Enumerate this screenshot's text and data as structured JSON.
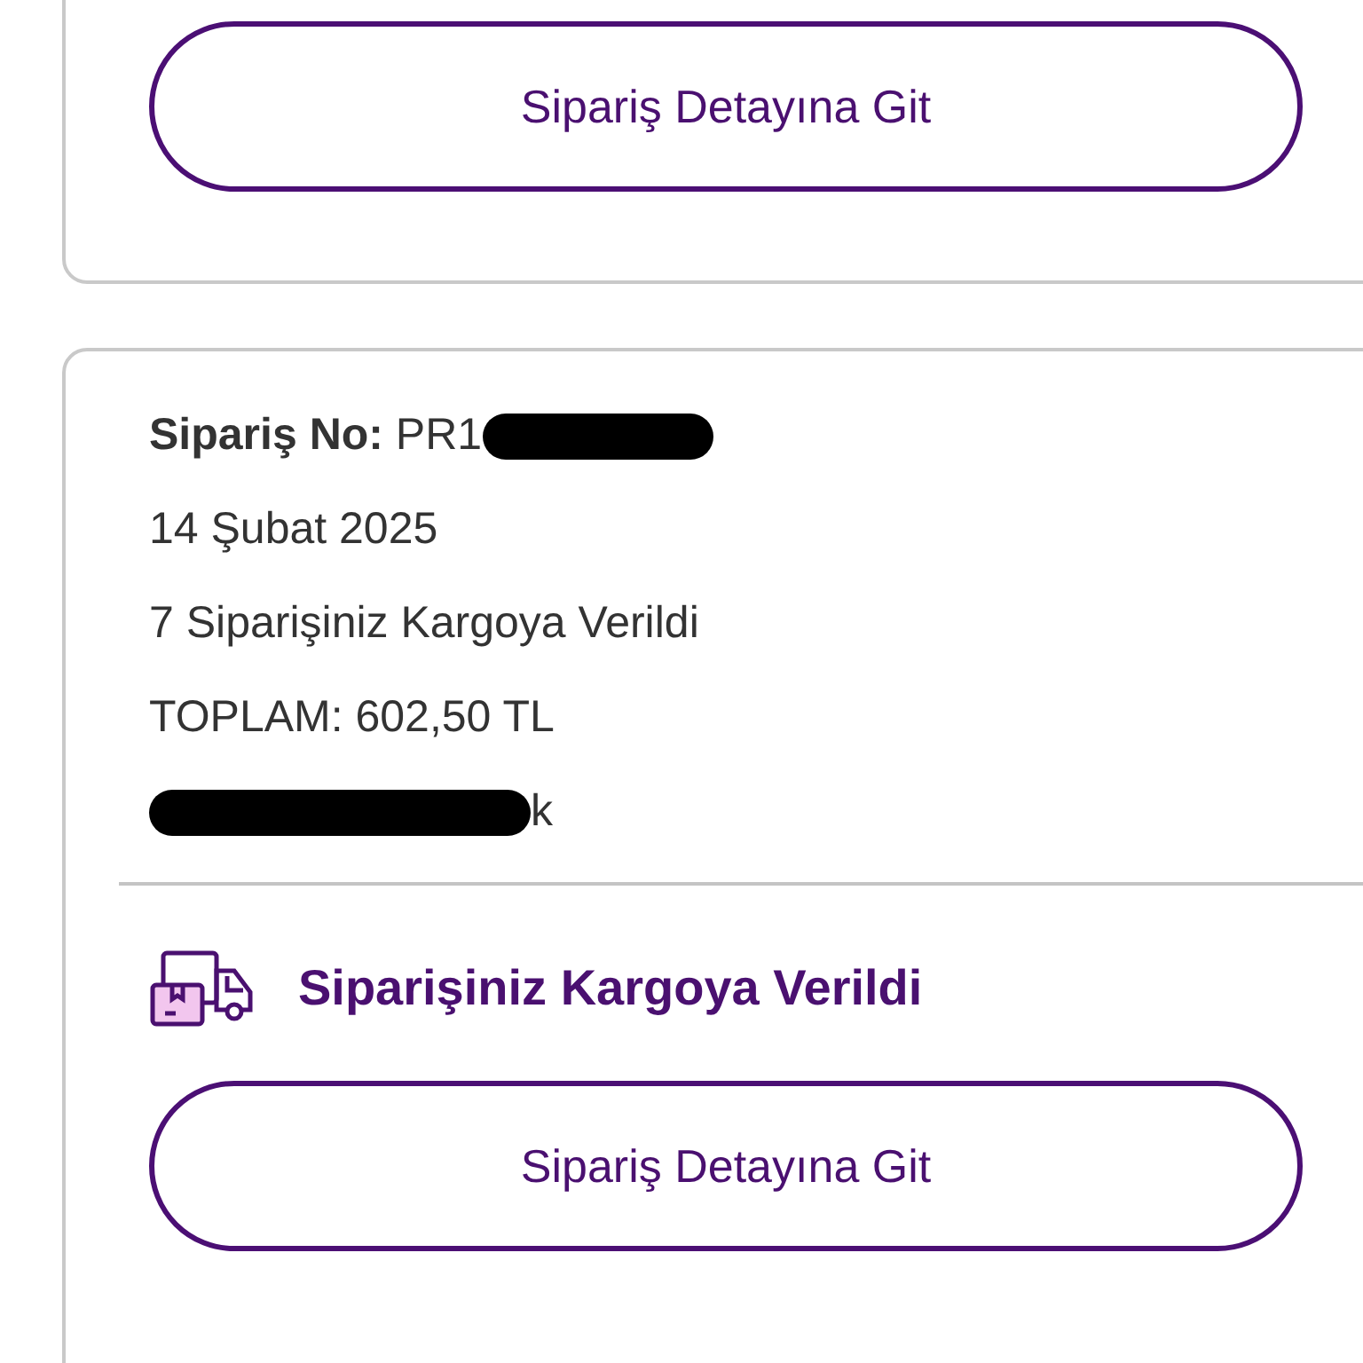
{
  "orders": [
    {
      "button": "Sipariş Detayına Git"
    },
    {
      "lines": [
        {
          "text": "**Sipariş No:** PR1",
          "redacted": true
        },
        {
          "text": "14 Şubat 2025",
          "redacted": false
        },
        {
          "text": "7 Siparişiniz Kargoya Verildi",
          "redacted": false
        },
        {
          "text": "TOPLAM: 602,50 TL",
          "redacted": false
        },
        {
          "text": "k",
          "redacted": true,
          "redaction_first": true
        }
      ],
      "status": "Siparişiniz Kargoya Verildi",
      "button": "Sipariş Detayına Git"
    }
  ]
}
